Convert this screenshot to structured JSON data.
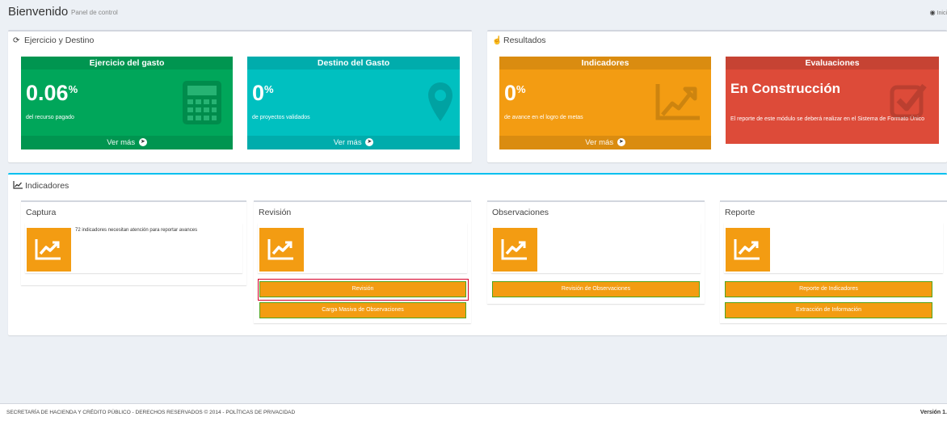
{
  "header": {
    "title": "Bienvenido",
    "subtitle": "Panel de control",
    "breadcrumb": "Inici"
  },
  "ejercicio_box": {
    "title": "Ejercicio y Destino",
    "tiles": [
      {
        "header": "Ejercicio del gasto",
        "value": "0.06",
        "unit": "%",
        "desc": "del recurso pagado",
        "link": "Ver más"
      },
      {
        "header": "Destino del Gasto",
        "value": "0",
        "unit": "%",
        "desc": "de proyectos validados",
        "link": "Ver más"
      }
    ]
  },
  "resultados_box": {
    "title": "Resultados",
    "tiles": [
      {
        "header": "Indicadores",
        "value": "0",
        "unit": "%",
        "desc": "de avance en el logro de metas",
        "link": "Ver más"
      },
      {
        "header": "Evaluaciones",
        "value": "En Construcción",
        "desc": "El reporte de este módulo se deberá realizar en el Sistema de Formato Único"
      }
    ]
  },
  "indicadores": {
    "title": "Indicadores",
    "sections": [
      {
        "title": "Captura",
        "text": "72 indicadores necesitan atención para reportar avances"
      },
      {
        "title": "Revisión",
        "buttons": [
          "Revisión",
          "Carga Masiva de Observaciones"
        ]
      },
      {
        "title": "Observaciones",
        "buttons": [
          "Revisión de Observaciones"
        ]
      },
      {
        "title": "Reporte",
        "buttons": [
          "Reporte de Indicadores",
          "Extracción de Información"
        ]
      }
    ]
  },
  "footer": {
    "left": "SECRETARÍA DE HACIENDA Y CRÉDITO PÚBLICO - DERECHOS RESERVADOS © 2014 - POLÍTICAS DE PRIVACIDAD",
    "right": "Versión 1."
  },
  "icons": [
    "refresh-icon",
    "thumbs-up-icon",
    "line-chart-icon",
    "calculator-icon",
    "map-marker-icon",
    "area-chart-icon",
    "check-square-icon",
    "arrow-circle-right-icon",
    "dashboard-icon"
  ],
  "colors": {
    "green": "#00a65a",
    "aqua": "#00c0c0",
    "orange": "#f39c12",
    "red": "#dd4b39",
    "info_border": "#00c0ef",
    "button_border": "#52a51e",
    "highlight": "#d6002a"
  }
}
